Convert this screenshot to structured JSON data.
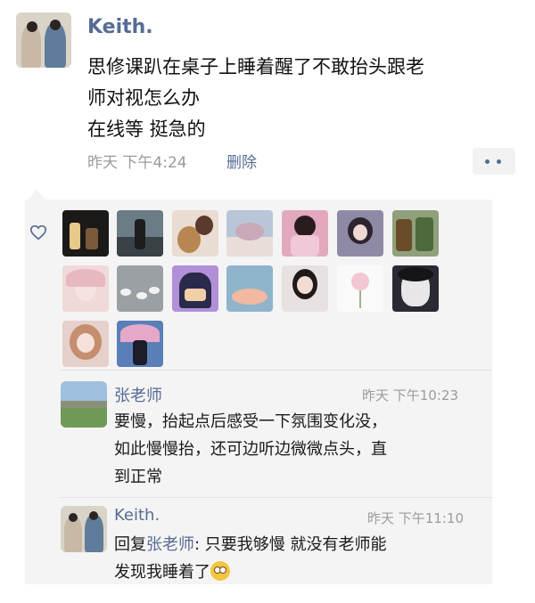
{
  "post": {
    "author": "Keith.",
    "text_lines": [
      "思修课趴在桌子上睡着醒了不敢抬头跟老",
      "师对视怎么办",
      "在线等 挺急的"
    ],
    "time": "昨天 下午4:24",
    "delete_label": "删除"
  },
  "comments": [
    {
      "author": "张老师",
      "time": "昨天 下午10:23",
      "lines": [
        "要慢，抬起点后感受一下氛围变化没，",
        "如此慢慢抬，还可边听边微微点头，直",
        "到正常"
      ]
    },
    {
      "author": "Keith.",
      "time": "昨天 下午11:10",
      "reply_prefix": "回复",
      "reply_to": "张老师",
      "line1_rest": ": 只要我够慢 就没有老师能",
      "line2": "发现我睡着了"
    }
  ],
  "icons": {
    "like": "heart-icon",
    "more": "more-dots-icon",
    "emoji": "flushed-emoji-icon"
  },
  "colors": {
    "link": "#576b95",
    "meta": "#9b9b9b",
    "likes_bg": "#f4f4f4"
  }
}
